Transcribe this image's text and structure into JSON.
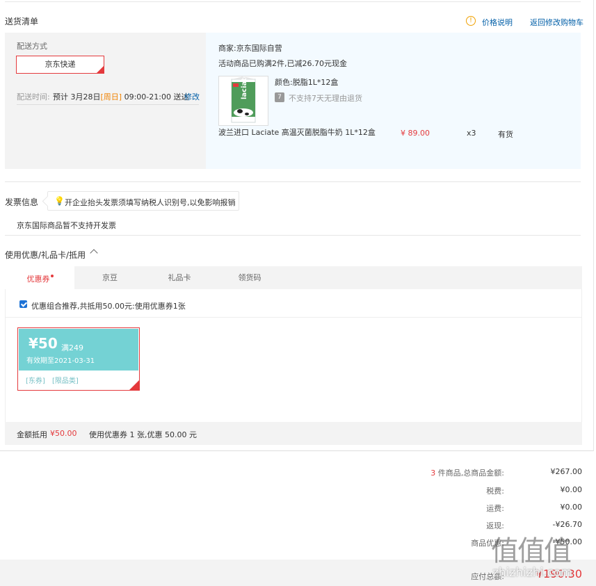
{
  "delivery": {
    "section_title": "送货清单",
    "price_note_link": "价格说明",
    "back_cart_link": "返回修改购物车",
    "ship_method_label": "配送方式",
    "ship_method_value": "京东快递",
    "ship_time_label": "配送时间:",
    "ship_time_prefix": "预计 3月28日",
    "ship_time_day": "[周日]",
    "ship_time_suffix": "09:00-21:00 送达",
    "modify_link": "修改",
    "merchant": "商家:京东国际自营",
    "promo_note": "活动商品已购满2件,已减26.70元现金",
    "product": {
      "color": "颜色:脱脂1L*12盒",
      "return_note": "不支持7天无理由退货",
      "name": "波兰进口 Laciate 高温灭菌脱脂牛奶 1L*12盒",
      "price": "¥ 89.00",
      "qty": "x3",
      "stock": "有货",
      "img_text": "laciate"
    }
  },
  "invoice": {
    "title": "发票信息",
    "tip": "开企业抬头发票须填写纳税人识别号,以免影响报销",
    "note": "京东国际商品暂不支持开发票"
  },
  "discount": {
    "title": "使用优惠/礼品卡/抵用",
    "tabs": [
      "优惠券",
      "京豆",
      "礼品卡",
      "领货码"
    ],
    "recommend_text": "优惠组合推荐,共抵用50.00元:使用优惠券1张",
    "coupon": {
      "amount": "¥50",
      "condition": "满249",
      "valid": "有效期至2021-03-31",
      "tag1": "[东券]",
      "tag2": "[限品类]"
    },
    "summary_label": "金额抵用",
    "summary_amount": "¥50.00",
    "summary_text": "使用优惠券 1 张,优惠 50.00 元"
  },
  "totals": {
    "count": "3",
    "count_suffix": "件商品,总商品金额:",
    "total": "¥267.00",
    "tax_label": "税费:",
    "tax": "¥0.00",
    "freight_label": "运费:",
    "freight": "¥0.00",
    "rebate_label": "返现:",
    "rebate": "-¥26.70",
    "coupon_label": "商品优惠:",
    "coupon": "-¥50.00",
    "pay_label": "应付总额:",
    "pay": "¥190.30"
  },
  "watermark": {
    "logo": "值值值",
    "url": "zhizhizhi.com"
  },
  "colors": {
    "accent": "#e4393c",
    "link": "#005ea7",
    "coupon": "#74d2d4"
  }
}
